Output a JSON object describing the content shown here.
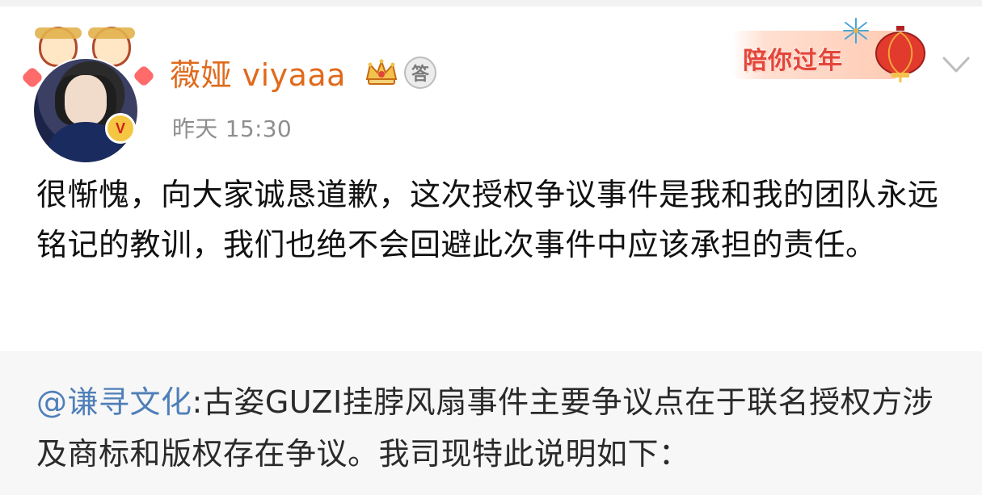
{
  "user": {
    "name": "薇娅 viyaaa",
    "time": "昨天 15:30",
    "answer_badge": "答"
  },
  "festival_badge": {
    "text": "陪你过年"
  },
  "post": {
    "text": "很惭愧，向大家诚恳道歉，这次授权争议事件是我和我的团队永远铭记的教训，我们也绝不会回避此次事件中应该承担的责任。"
  },
  "repost": {
    "mention": "@谦寻文化",
    "text": ":古姿GUZI挂脖风扇事件主要争议点在于联名授权方涉及商标和版权存在争议。我司现特此说明如下："
  },
  "icons": {
    "crown": "crown-icon",
    "chevron": "chevron-down-icon",
    "verified": "verified-badge-icon"
  },
  "colors": {
    "name": "#e06a1c",
    "time": "#8e8e8e",
    "mention": "#4f7fb8",
    "repost_bg": "#f7f7f7"
  }
}
